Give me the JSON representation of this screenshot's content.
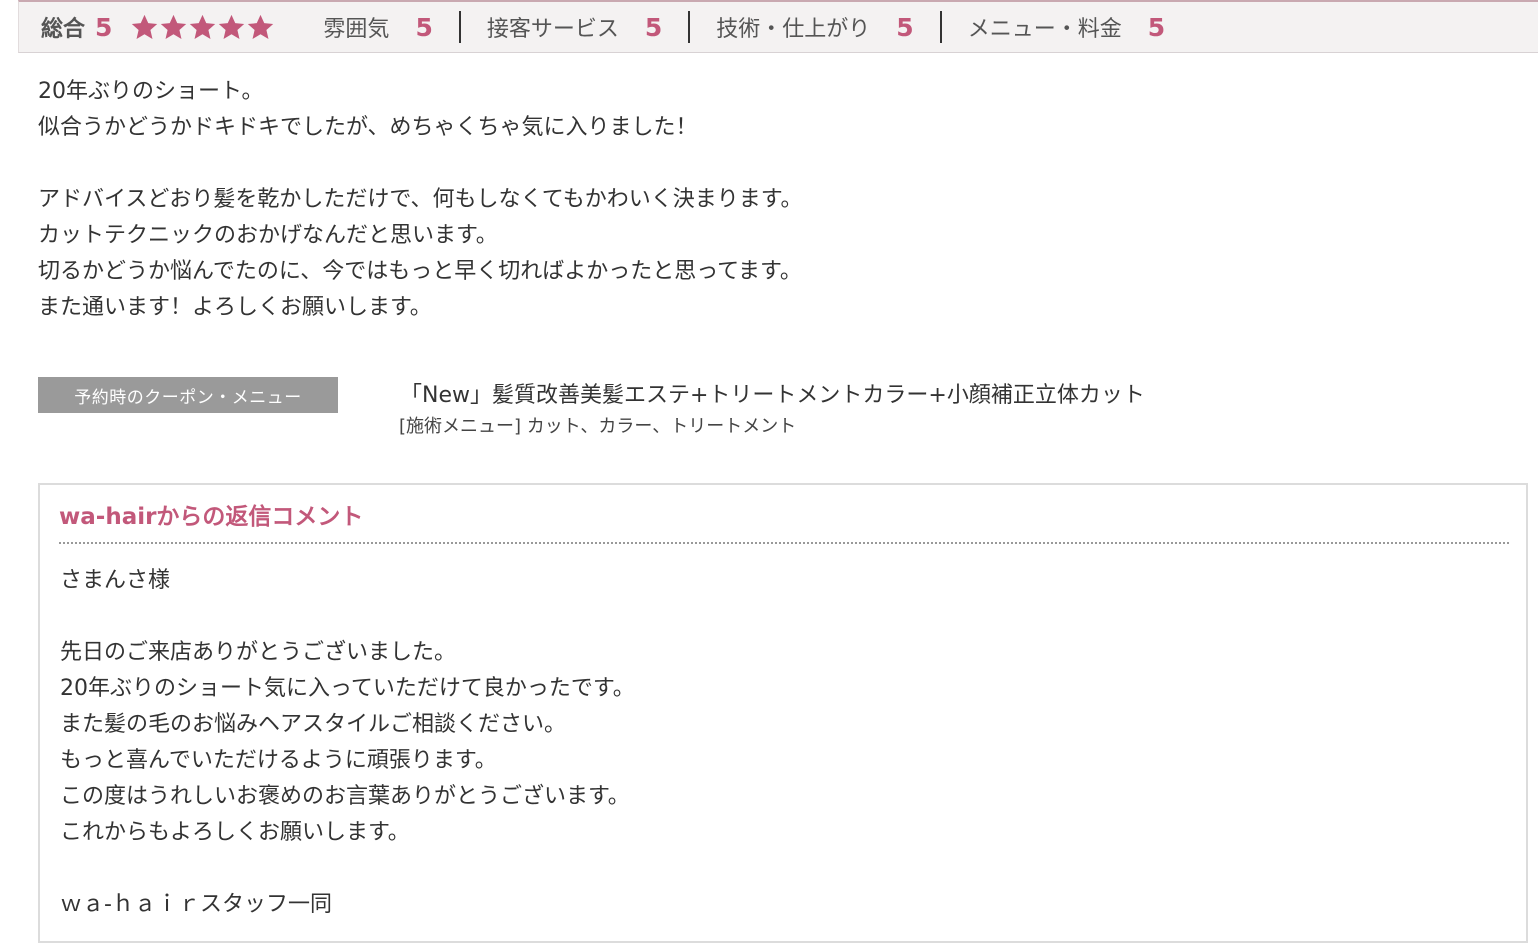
{
  "rating": {
    "overall_label": "総合",
    "overall_score": "5",
    "star_count": 5,
    "star_color": "#c2587a",
    "categories": [
      {
        "label": "雰囲気",
        "score": "5"
      },
      {
        "label": "接客サービス",
        "score": "5"
      },
      {
        "label": "技術・仕上がり",
        "score": "5"
      },
      {
        "label": "メニュー・料金",
        "score": "5"
      }
    ]
  },
  "review": {
    "lines": [
      "20年ぶりのショート。",
      "似合うかどうかドキドキでしたが、めちゃくちゃ気に入りました！",
      "",
      "アドバイスどおり髪を乾かしただけで、何もしなくてもかわいく決まります。",
      "カットテクニックのおかげなんだと思います。",
      "切るかどうか悩んでたのに、今ではもっと早く切ればよかったと思ってます。",
      "また通います！よろしくお願いします。"
    ]
  },
  "coupon": {
    "label": "予約時のクーポン・メニュー",
    "title": "「New」髪質改善美髪エステ+トリートメントカラー+小顔補正立体カット",
    "menu": "[施術メニュー]  カット、カラー、トリートメント"
  },
  "reply": {
    "title": "wa-hairからの返信コメント",
    "lines": [
      "さまんさ様",
      "",
      "先日のご来店ありがとうございました。",
      "20年ぶりのショート気に入っていただけて良かったです。",
      "また髪の毛のお悩みヘアスタイルご相談ください。",
      "もっと喜んでいただけるように頑張ります。",
      "この度はうれしいお褒めのお言葉ありがとうございます。",
      "これからもよろしくお願いします。",
      "",
      "ｗａ-ｈａｉｒスタッフ一同"
    ]
  }
}
